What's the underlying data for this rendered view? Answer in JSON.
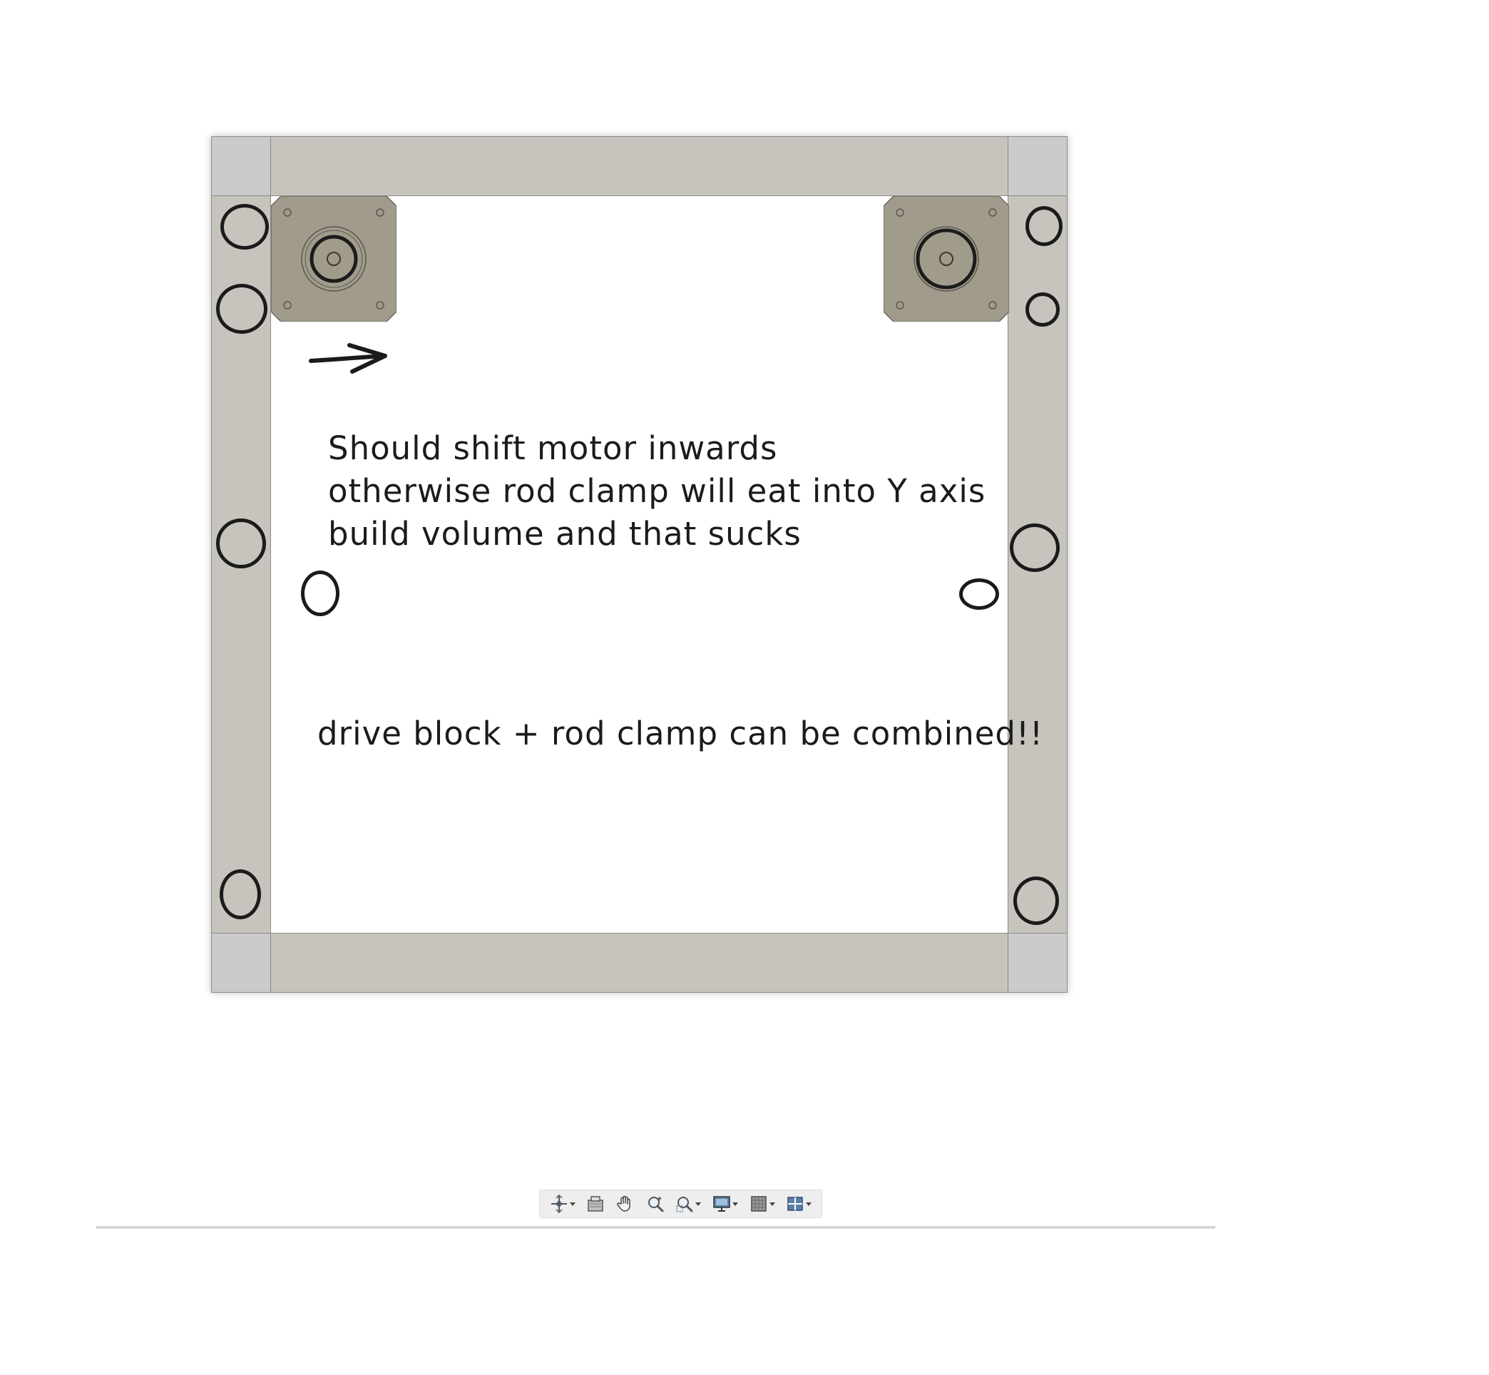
{
  "annotations": {
    "note_line_1": "Should shift motor inwards",
    "note_line_2": "otherwise rod clamp will eat into Y axis",
    "note_line_3": "build volume and that sucks",
    "note_combined": "drive block + rod clamp can be combined!!"
  },
  "colors": {
    "rail": "#c7c4bd",
    "corner": "#cbcbcb",
    "motor": "#a19b8b",
    "ink": "#1b1b1b",
    "toolbar_bg": "#eeeeee"
  },
  "toolbar": {
    "items": [
      {
        "icon": "orbit-icon",
        "has_dropdown": true
      },
      {
        "icon": "look-at-icon",
        "has_dropdown": false
      },
      {
        "icon": "pan-hand-icon",
        "has_dropdown": false
      },
      {
        "icon": "zoom-icon",
        "has_dropdown": false
      },
      {
        "icon": "fit-zoom-window-icon",
        "has_dropdown": true
      },
      {
        "icon": "display-settings-icon",
        "has_dropdown": true
      },
      {
        "icon": "grid-snaps-icon",
        "has_dropdown": true
      },
      {
        "icon": "viewports-icon",
        "has_dropdown": true
      }
    ]
  }
}
